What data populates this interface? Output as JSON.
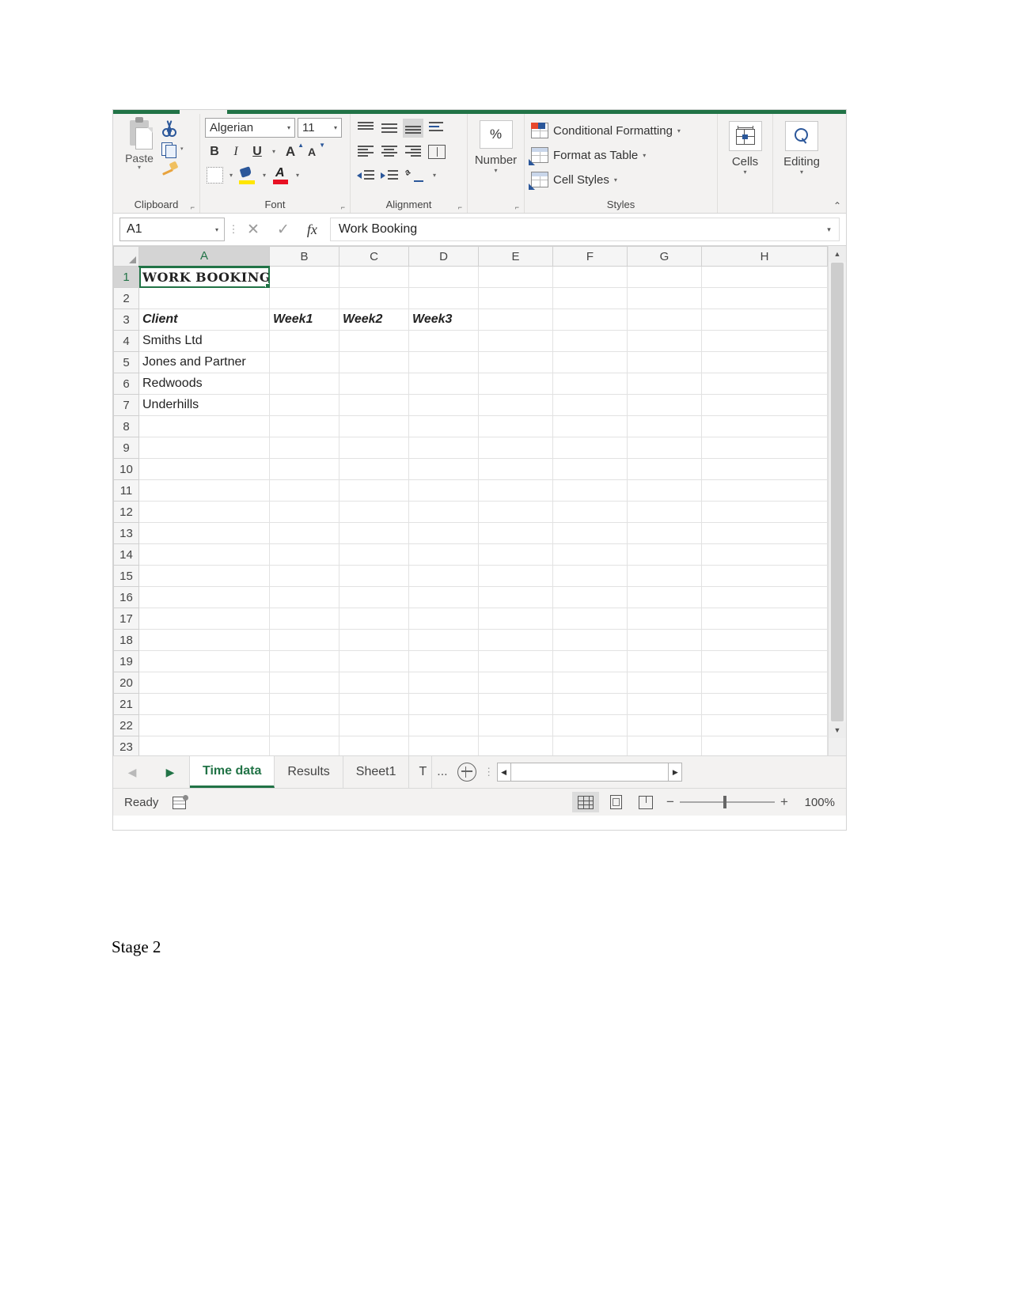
{
  "ribbon": {
    "clipboard": {
      "group_label": "Clipboard",
      "paste_label": "Paste",
      "cut_icon": "scissors-icon",
      "copy_icon": "copy-icon",
      "format_painter_icon": "format-painter-icon",
      "dialog_launcher": "⌐"
    },
    "font": {
      "group_label": "Font",
      "font_name": "Algerian",
      "font_size": "11",
      "bold": "B",
      "italic": "I",
      "underline": "U",
      "grow_font": "A",
      "shrink_font": "A",
      "borders_icon": "borders-icon",
      "fill_color_icon": "fill-color-icon",
      "font_color_icon": "font-color-icon"
    },
    "alignment": {
      "group_label": "Alignment",
      "top_align": "top-align-icon",
      "middle_align": "middle-align-icon",
      "bottom_align": "bottom-align-icon",
      "wrap_text": "wrap-text-icon",
      "align_left": "align-left-icon",
      "align_center": "align-center-icon",
      "align_right": "align-right-icon",
      "merge_center": "merge-center-icon",
      "decrease_indent": "decrease-indent-icon",
      "increase_indent": "increase-indent-icon",
      "orientation": "orientation-icon"
    },
    "number": {
      "group_label": "Number",
      "percent_style": "%"
    },
    "styles": {
      "group_label": "Styles",
      "items": [
        {
          "label": "Conditional Formatting",
          "icon": "conditional-formatting-icon"
        },
        {
          "label": "Format as Table",
          "icon": "format-as-table-icon"
        },
        {
          "label": "Cell Styles",
          "icon": "cell-styles-icon"
        }
      ]
    },
    "cells": {
      "group_label": "Cells",
      "icon": "cells-icon"
    },
    "editing": {
      "group_label": "Editing",
      "icon": "find-select-icon"
    },
    "collapse_icon": "chevron-up-icon"
  },
  "formula_bar": {
    "name_box": "A1",
    "cancel_icon": "✕",
    "enter_icon": "✓",
    "function_icon": "fx",
    "formula_value": "Work Booking"
  },
  "grid": {
    "columns": [
      "A",
      "B",
      "C",
      "D",
      "E",
      "F",
      "G",
      "H"
    ],
    "selected_column": "A",
    "selected_row": 1,
    "selected_cell": "A1",
    "rows": [
      {
        "num": "1",
        "cells": {
          "A": "WORK BOOKING"
        },
        "styles": {
          "A": "title"
        }
      },
      {
        "num": "2",
        "cells": {}
      },
      {
        "num": "3",
        "cells": {
          "A": "Client",
          "B": "Week1",
          "C": "Week2",
          "D": "Week3"
        },
        "styles": {
          "A": "header",
          "B": "header",
          "C": "header",
          "D": "header"
        }
      },
      {
        "num": "4",
        "cells": {
          "A": "Smiths Ltd"
        }
      },
      {
        "num": "5",
        "cells": {
          "A": "Jones and Partner"
        }
      },
      {
        "num": "6",
        "cells": {
          "A": "Redwoods"
        }
      },
      {
        "num": "7",
        "cells": {
          "A": "Underhills"
        }
      },
      {
        "num": "8",
        "cells": {}
      },
      {
        "num": "9",
        "cells": {}
      },
      {
        "num": "10",
        "cells": {}
      },
      {
        "num": "11",
        "cells": {}
      },
      {
        "num": "12",
        "cells": {}
      },
      {
        "num": "13",
        "cells": {}
      },
      {
        "num": "14",
        "cells": {}
      },
      {
        "num": "15",
        "cells": {}
      },
      {
        "num": "16",
        "cells": {}
      },
      {
        "num": "17",
        "cells": {}
      },
      {
        "num": "18",
        "cells": {}
      },
      {
        "num": "19",
        "cells": {}
      },
      {
        "num": "20",
        "cells": {}
      },
      {
        "num": "21",
        "cells": {}
      },
      {
        "num": "22",
        "cells": {}
      },
      {
        "num": "23",
        "cells": {}
      }
    ],
    "scroll_up_icon": "▲",
    "scroll_down_icon": "▼"
  },
  "sheet_tabs": {
    "first_icon": "◀",
    "prev_icon": "▶",
    "tabs": [
      {
        "label": "Time data",
        "active": true
      },
      {
        "label": "Results",
        "active": false
      },
      {
        "label": "Sheet1",
        "active": false
      },
      {
        "label": "T",
        "active": false
      }
    ],
    "overflow": "...",
    "add_sheet_icon": "plus-circle-icon",
    "hscroll_left": "◀",
    "hscroll_right": "▶"
  },
  "status_bar": {
    "state": "Ready",
    "macro_icon": "record-macro-icon",
    "view_normal": "normal-view-icon",
    "view_page_layout": "page-layout-view-icon",
    "view_page_break": "page-break-view-icon",
    "zoom_out": "−",
    "zoom_in": "+",
    "zoom_level": "100%"
  },
  "page": {
    "caption": "Stage 2"
  },
  "colors": {
    "accent_green": "#217346",
    "ribbon_bg": "#f3f2f1",
    "grid_line": "#e2e2e2",
    "header_bg": "#f5f5f5"
  }
}
